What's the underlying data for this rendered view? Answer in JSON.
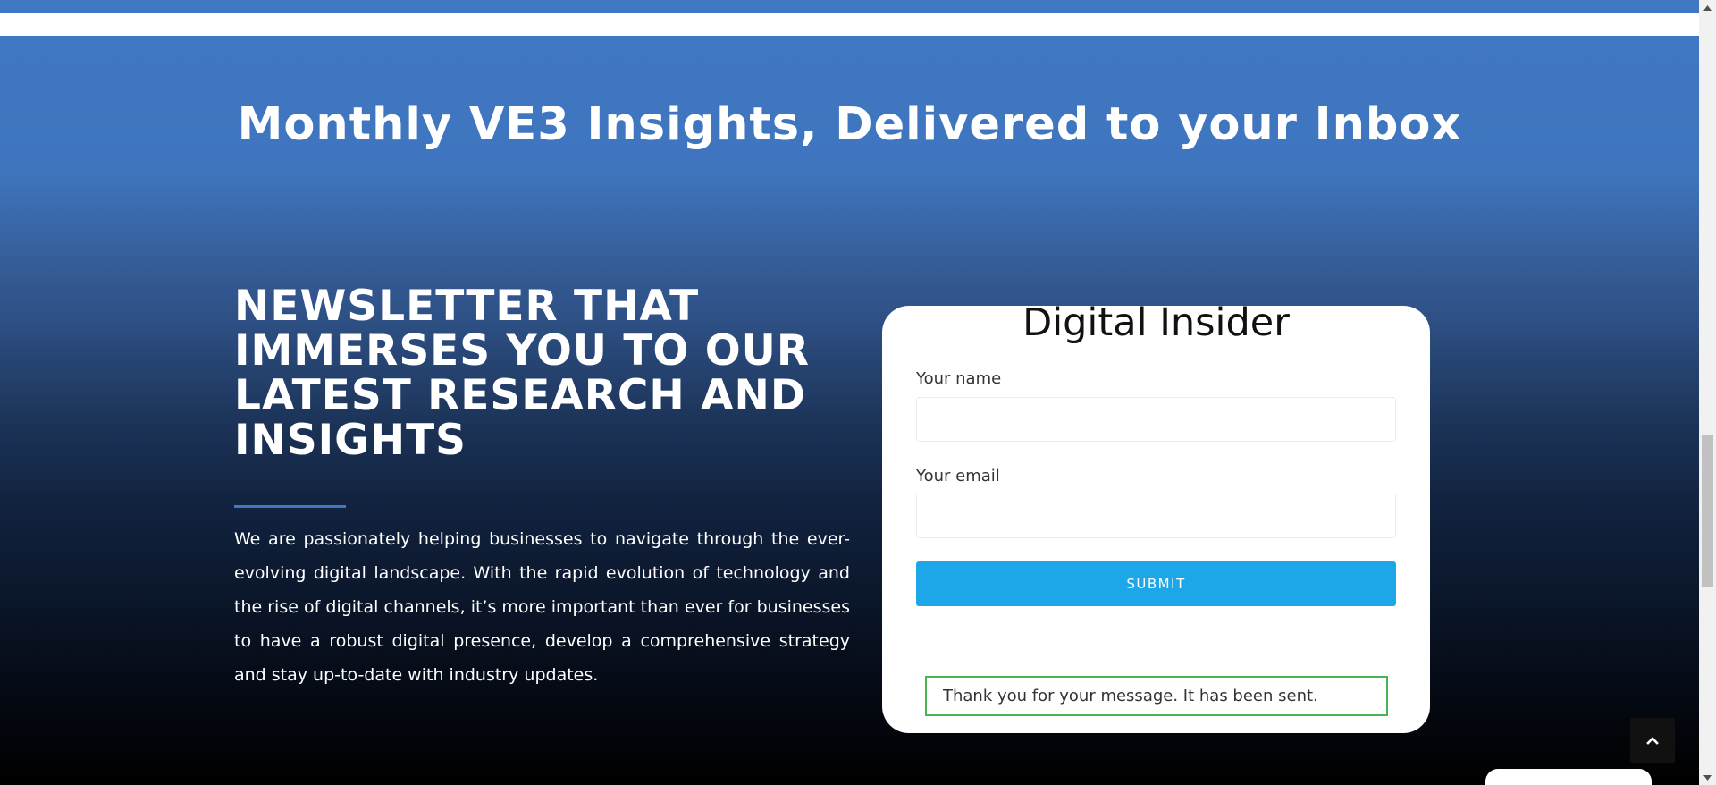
{
  "hero": {
    "title": "Monthly VE3 Insights, Delivered to your Inbox"
  },
  "newsletter": {
    "heading_lines": [
      "NEWSLETTER THAT",
      "IMMERSES YOU TO OUR",
      "LATEST RESEARCH AND",
      "INSIGHTS"
    ],
    "body": "We are passionately helping businesses to navigate through the ever-evolving digital landscape. With the rapid evolution of technology and the rise of digital channels, it’s more important than ever for businesses to have a robust digital presence, develop a comprehensive strategy and stay up-to-date with industry updates."
  },
  "form": {
    "title": "Digital Insider",
    "name_label": "Your name",
    "name_value": "",
    "email_label": "Your email",
    "email_value": "",
    "submit_label": "SUBMIT",
    "response_message": "Thank you for your message. It has been sent."
  },
  "icons": {
    "scroll_top": "chevron-up-icon",
    "scrollbar_up": "scroll-up-arrow-icon",
    "scrollbar_down": "scroll-down-arrow-icon"
  },
  "colors": {
    "brand_blue": "#4077c2",
    "submit_blue": "#1ea7e8",
    "success_green": "#46b450",
    "card_background": "#ffffff"
  }
}
